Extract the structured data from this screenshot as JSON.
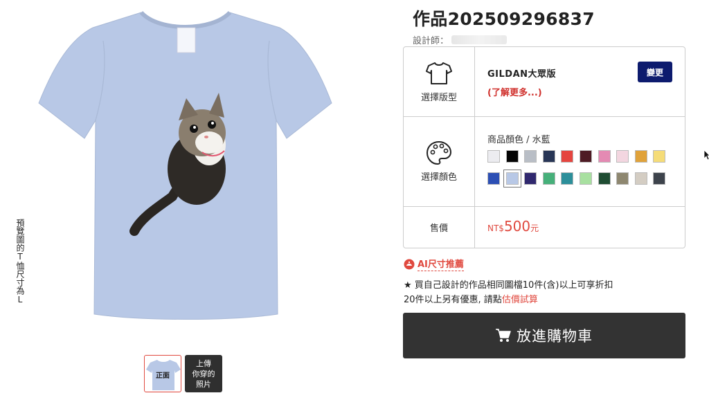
{
  "preview": {
    "size_note": "預覽圖的T恤尺寸為L",
    "thumbs": [
      {
        "label": "正面"
      },
      {
        "label": "上傳\n你穿的\n照片"
      }
    ]
  },
  "product": {
    "title": "作品202509296837",
    "designer_label": "設計師："
  },
  "options": {
    "style": {
      "label": "選擇版型",
      "name": "GILDAN大眾版",
      "learn_more": "(了解更多...)",
      "change_button": "變更"
    },
    "color": {
      "label": "選擇顏色",
      "current": "商品顏色 / 水藍",
      "swatches": [
        {
          "name": "white-swatch",
          "hex": "#ececf0"
        },
        {
          "name": "black-swatch",
          "hex": "#050505"
        },
        {
          "name": "heather-gray-swatch",
          "hex": "#b9bec6"
        },
        {
          "name": "navy-swatch",
          "hex": "#283656"
        },
        {
          "name": "red-swatch",
          "hex": "#e5453f"
        },
        {
          "name": "maroon-swatch",
          "hex": "#4e1b24"
        },
        {
          "name": "pink-swatch",
          "hex": "#e48ab3"
        },
        {
          "name": "light-pink-swatch",
          "hex": "#f3d6e0"
        },
        {
          "name": "gold-swatch",
          "hex": "#e0a23a"
        },
        {
          "name": "yellow-swatch",
          "hex": "#f5dc78"
        },
        {
          "name": "royal-blue-swatch",
          "hex": "#2c4fb4"
        },
        {
          "name": "light-blue-swatch",
          "hex": "#b8c8e6"
        },
        {
          "name": "purple-swatch",
          "hex": "#30286e"
        },
        {
          "name": "green-swatch",
          "hex": "#46b07a"
        },
        {
          "name": "teal-swatch",
          "hex": "#2c8f9a"
        },
        {
          "name": "mint-swatch",
          "hex": "#a8e0a0"
        },
        {
          "name": "forest-green-swatch",
          "hex": "#1f4d33"
        },
        {
          "name": "khaki-swatch",
          "hex": "#8e8770"
        },
        {
          "name": "sand-swatch",
          "hex": "#d4cdc3"
        },
        {
          "name": "charcoal-swatch",
          "hex": "#3d434c"
        }
      ],
      "selected_index": 11
    },
    "price": {
      "label": "售價",
      "currency": "NT$",
      "amount": "500",
      "unit": "元"
    }
  },
  "ai_size": "AI尺寸推薦",
  "promo": {
    "line1": "★ 買自己設計的作品相同圖檔10件(含)以上可享折扣",
    "line2_prefix": "20件以上另有優惠, 請點",
    "line2_link": "估價試算"
  },
  "cart_button": "放進購物車",
  "colors": {
    "accent_red": "#e0493f",
    "navy_button": "#0d1b6e",
    "cart_bg": "#333333",
    "shirt": "#b8c8e6"
  }
}
